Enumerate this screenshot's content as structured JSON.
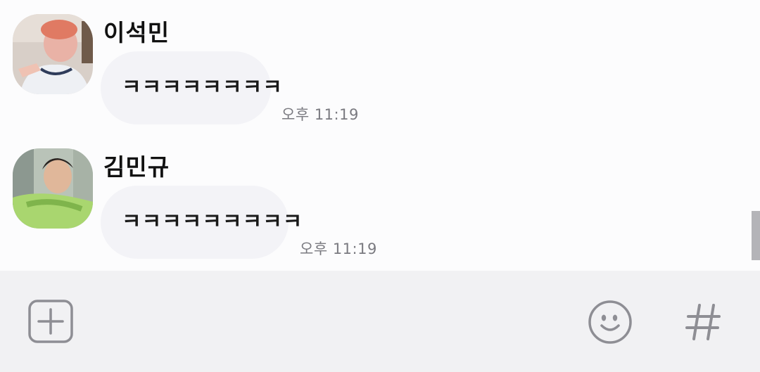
{
  "messages": [
    {
      "sender": "이석민",
      "text": "ㅋㅋㅋㅋㅋㅋㅋㅋ",
      "time": "오후 11:19"
    },
    {
      "sender": "김민규",
      "text": "ㅋㅋㅋㅋㅋㅋㅋㅋㅋ",
      "time": "오후 11:19"
    }
  ],
  "input_bar": {
    "left_icon": "add-icon",
    "emoji_icon": "smiley-icon",
    "hashtag_icon": "hashtag-icon",
    "hashtag_glyph": "#"
  },
  "colors": {
    "chat_background": "#fcfcfd",
    "bubble": "#f3f3f7",
    "input_bar": "#f1f1f3",
    "icon_gray": "#8e8e94",
    "time_text": "#7a7a80"
  }
}
